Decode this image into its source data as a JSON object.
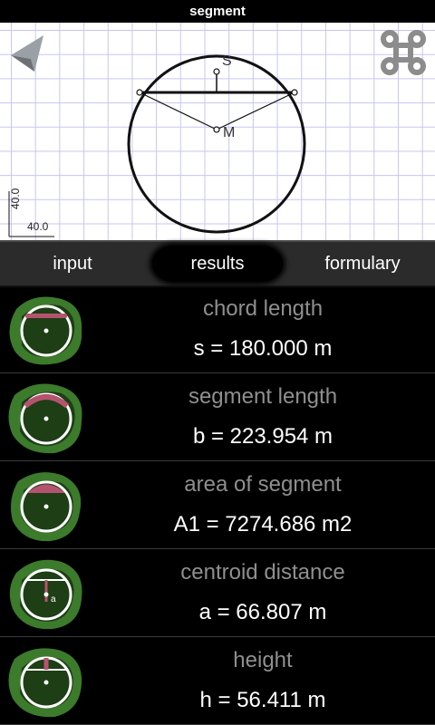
{
  "app": {
    "title": "segment"
  },
  "canvas": {
    "point_s": "S",
    "point_m": "M",
    "scale_vertical": "40.0",
    "scale_horizontal": "40.0"
  },
  "tabs": [
    {
      "label": "input"
    },
    {
      "label": "results"
    },
    {
      "label": "formulary"
    }
  ],
  "results": [
    {
      "label": "chord length",
      "value": "s = 180.000 m",
      "icon": "chord-icon"
    },
    {
      "label": "segment length",
      "value": "b = 223.954 m",
      "icon": "arc-icon"
    },
    {
      "label": "area of segment",
      "value": "A1 = 7274.686 m2",
      "icon": "segment-area-icon"
    },
    {
      "label": "centroid distance",
      "value": "a = 66.807 m",
      "icon": "centroid-icon"
    },
    {
      "label": "height",
      "value": "h = 56.411 m",
      "icon": "height-icon"
    }
  ],
  "colors": {
    "highlight": "#b5536f",
    "blob": "#3c7a2c"
  }
}
